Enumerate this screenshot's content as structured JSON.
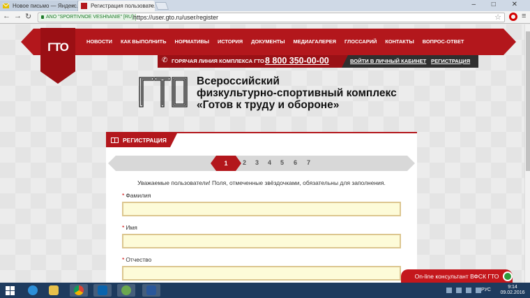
{
  "browser": {
    "tabs": [
      {
        "title": "Новое письмо — Яндекс...",
        "active": false
      },
      {
        "title": "Регистрация пользовате...",
        "active": true
      }
    ],
    "window_controls": "– □ ✕",
    "nav": {
      "back": "←",
      "forward": "→",
      "reload": "↻"
    },
    "ev_badge": "ANO \"SPORTIVNOE VESHhANIE\" [RU]",
    "url": "https://user.gto.ru/user/register",
    "bookmark_icon": "☆",
    "menu_icon": "≡"
  },
  "site": {
    "logo_text": "ГТО",
    "menu": [
      "НОВОСТИ",
      "КАК ВЫПОЛНИТЬ",
      "НОРМАТИВЫ",
      "ИСТОРИЯ",
      "ДОКУМЕНТЫ",
      "МЕДИАГАЛЕРЕЯ",
      "ГЛОССАРИЙ",
      "КОНТАКТЫ",
      "ВОПРОС-ОТВЕТ"
    ],
    "hotline_label": "ГОРЯЧАЯ ЛИНИЯ КОМПЛЕКСА ГТО",
    "phone": "8 800 350-00-00",
    "login_link": "ВОЙТИ В ЛИЧНЫЙ КАБИНЕТ",
    "register_link": "РЕГИСТРАЦИЯ",
    "title_lines": [
      "Всероссийский",
      "физкультурно-спортивный комплекс",
      "«Готов к труду и обороне»"
    ]
  },
  "form": {
    "tab_label": "РЕГИСТРАЦИЯ",
    "steps": [
      "1",
      "2",
      "3",
      "4",
      "5",
      "6",
      "7"
    ],
    "active_step": "1",
    "notice": "Уважаемые пользователи! Поля, отмеченные звёздочками, обязательны для заполнения.",
    "required_mark": "*",
    "fields": [
      {
        "label": "Фамилия",
        "value": ""
      },
      {
        "label": "Имя",
        "value": ""
      },
      {
        "label": "Отчество",
        "value": ""
      }
    ]
  },
  "consultant": {
    "label": "On-line консультант ВФСК ГТО"
  },
  "taskbar": {
    "lang": "РУС",
    "time": "9:14",
    "date": "09.02.2016",
    "apps": [
      "internet-explorer-icon",
      "file-explorer-icon",
      "chrome-icon",
      "outlook-icon",
      "app-icon",
      "word-icon"
    ]
  },
  "colors": {
    "brand_red": "#b3171c",
    "dark_red": "#9a1116",
    "input_bg": "#fdfbd8",
    "input_border": "#dcc68f"
  }
}
